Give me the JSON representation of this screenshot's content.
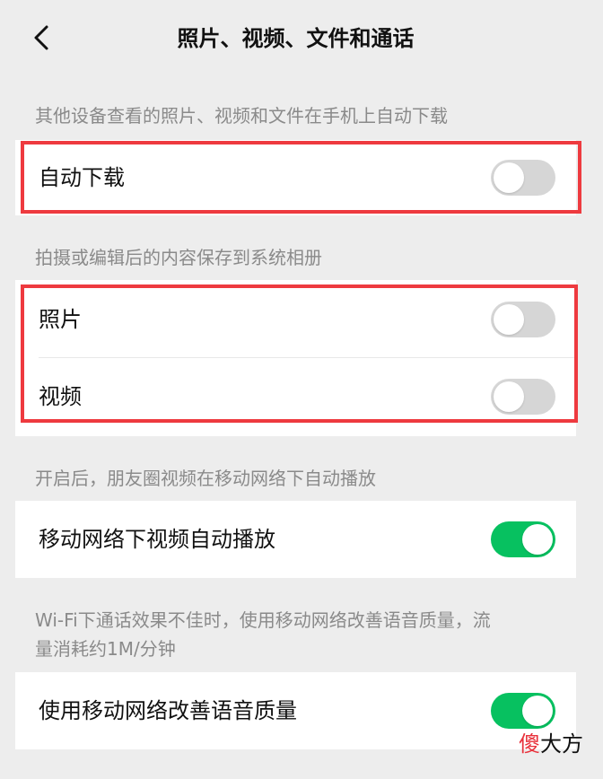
{
  "header": {
    "title": "照片、视频、文件和通话"
  },
  "sections": {
    "auto_download": {
      "description": "其他设备查看的照片、视频和文件在手机上自动下载",
      "item_label": "自动下载",
      "enabled": false
    },
    "save_to_album": {
      "description": "拍摄或编辑后的内容保存到系统相册",
      "photo_label": "照片",
      "photo_enabled": false,
      "video_label": "视频",
      "video_enabled": false
    },
    "mobile_autoplay": {
      "description": "开启后，朋友圈视频在移动网络下自动播放",
      "item_label": "移动网络下视频自动播放",
      "enabled": true
    },
    "voice_quality": {
      "description_line1": "Wi-Fi下通话效果不佳时，使用移动网络改善语音质量，流",
      "description_line2": "量消耗约1M/分钟",
      "item_label": "使用移动网络改善语音质量",
      "enabled": true
    }
  },
  "watermark": {
    "accent_char": "傻",
    "rest": "大方"
  },
  "colors": {
    "toggle_on": "#07c160",
    "toggle_off": "#d6d6d6",
    "highlight": "#ee3a3f",
    "background": "#ededed"
  },
  "icons": {
    "back": "chevron-left-icon"
  }
}
